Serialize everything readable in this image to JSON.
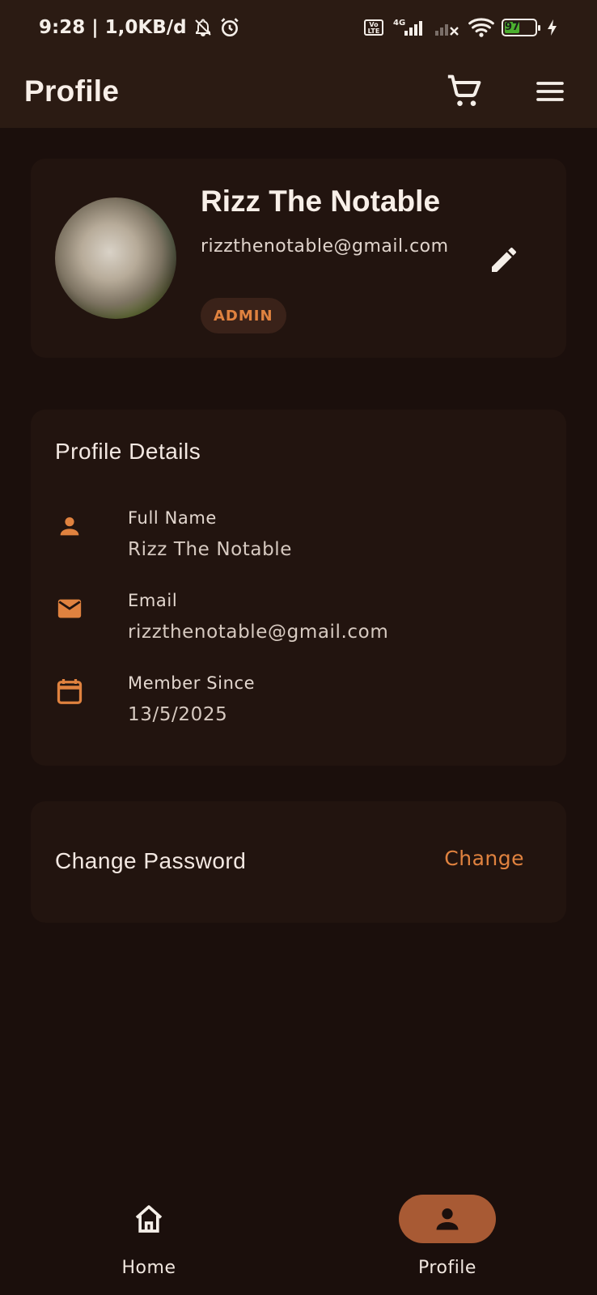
{
  "status_bar": {
    "time_text": "9:28 | 1,0KB/d",
    "network_label": "4G",
    "volte_label": "Vo LTE",
    "battery_level": "97",
    "icons": [
      "bell-off-icon",
      "alarm-icon",
      "volte-icon",
      "signal-icon",
      "signal-off-icon",
      "wifi-icon",
      "battery-icon",
      "charging-icon"
    ]
  },
  "app_bar": {
    "title": "Profile",
    "icons": [
      "cart-icon",
      "menu-icon"
    ]
  },
  "profile_card": {
    "name": "Rizz The Notable",
    "email": "rizzthenotable@gmail.com",
    "role": "ADMIN",
    "edit_icon": "pencil-icon"
  },
  "details": {
    "title": "Profile Details",
    "items": [
      {
        "label": "Full Name",
        "value": "Rizz The Notable",
        "icon": "person-icon"
      },
      {
        "label": "Email",
        "value": "rizzthenotable@gmail.com",
        "icon": "mail-icon"
      },
      {
        "label": "Member Since",
        "value": "13/5/2025",
        "icon": "calendar-icon"
      }
    ]
  },
  "password": {
    "label": "Change Password",
    "action": "Change"
  },
  "bottom_nav": {
    "items": [
      {
        "label": "Home",
        "icon": "home-icon",
        "active": false
      },
      {
        "label": "Profile",
        "icon": "person-icon",
        "active": true
      }
    ]
  },
  "colors": {
    "background": "#1b0f0c",
    "app_bar": "#2b1b13",
    "card": "#22140f",
    "accent": "#e0823f",
    "active_pill": "#a85a34"
  }
}
